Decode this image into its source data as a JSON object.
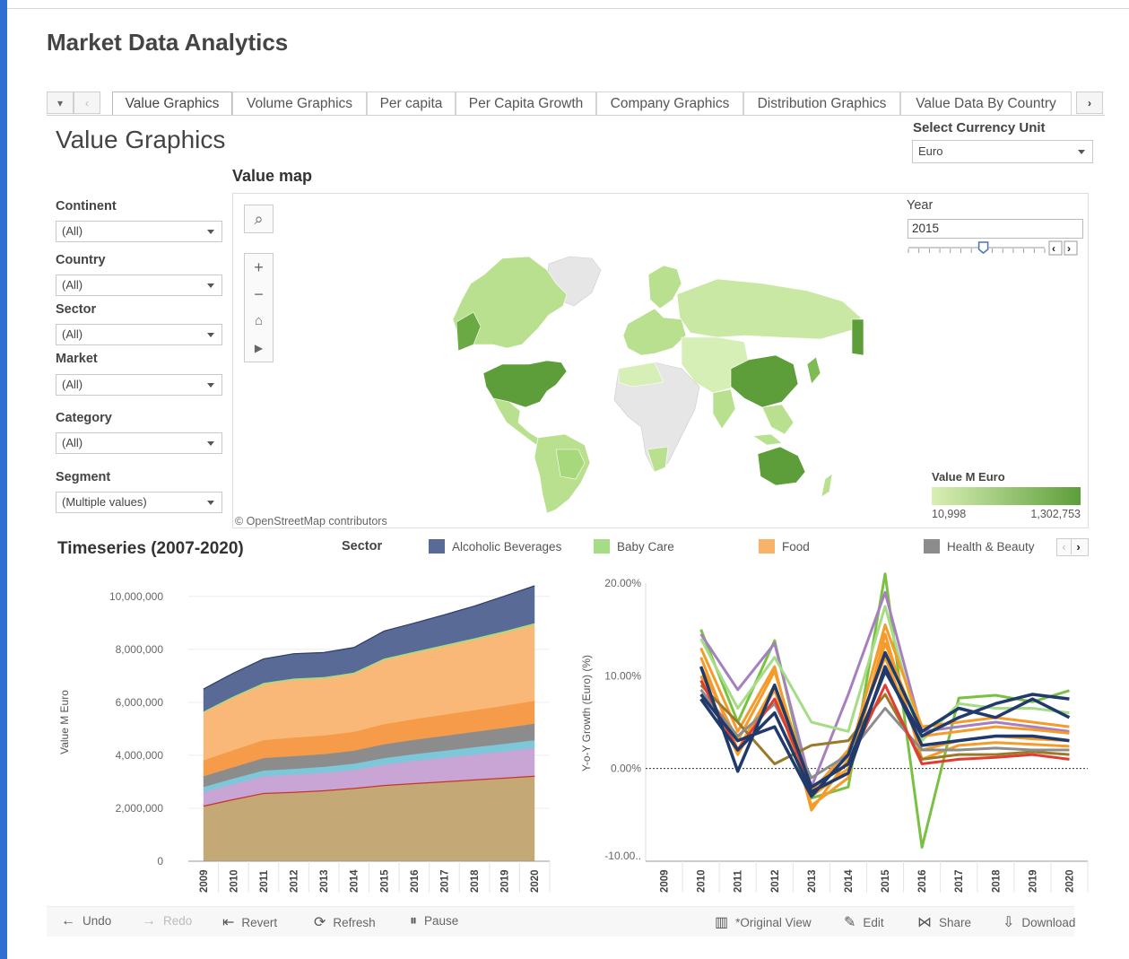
{
  "app_title": "Market Data Analytics",
  "tabs": {
    "items": [
      {
        "label": "Value Graphics",
        "active": true
      },
      {
        "label": "Volume Graphics"
      },
      {
        "label": "Per capita"
      },
      {
        "label": "Per Capita Growth"
      },
      {
        "label": "Company Graphics"
      },
      {
        "label": "Distribution Graphics"
      },
      {
        "label": "Value Data By Country"
      }
    ]
  },
  "dashboard_title": "Value Graphics",
  "currency": {
    "label": "Select Currency Unit",
    "value": "Euro"
  },
  "filters": [
    {
      "label": "Continent",
      "value": "(All)"
    },
    {
      "label": "Country",
      "value": "(All)"
    },
    {
      "label": "Sector",
      "value": "(All)"
    },
    {
      "label": "Market",
      "value": "(All)"
    },
    {
      "label": "Category",
      "value": "(All)"
    },
    {
      "label": "Segment",
      "value": "(Multiple values)"
    }
  ],
  "map": {
    "title": "Value map",
    "attribution": "© OpenStreetMap contributors",
    "year_label": "Year",
    "year_value": "2015",
    "legend_title": "Value M Euro",
    "legend_min": "10,998",
    "legend_max": "1,302,753",
    "legend_color_low": "#d9efb4",
    "legend_color_high": "#5d9e3a",
    "year_slider_fraction": 0.55
  },
  "timeseries": {
    "title": "Timeseries (2007-2020)",
    "legend_title": "Sector",
    "legend": [
      {
        "name": "Alcoholic Beverages",
        "color": "#5a6a96"
      },
      {
        "name": "Baby Care",
        "color": "#a5dc85"
      },
      {
        "name": "Food",
        "color": "#f9b26a"
      },
      {
        "name": "Health & Beauty",
        "color": "#8c8c8c"
      }
    ]
  },
  "chart_data": [
    {
      "type": "area",
      "ylabel": "Value M Euro",
      "ylim": [
        0,
        10500000
      ],
      "yticks": [
        "0",
        "2,000,000",
        "4,000,000",
        "6,000,000",
        "8,000,000",
        "10,000,000"
      ],
      "x": [
        "2009",
        "2010",
        "2011",
        "2012",
        "2013",
        "2014",
        "2015",
        "2016",
        "2017",
        "2018",
        "2019",
        "2020"
      ],
      "series": [
        {
          "color": "#c4a876",
          "values": [
            2100000,
            2350000,
            2580000,
            2620000,
            2680000,
            2770000,
            2880000,
            2950000,
            3020000,
            3090000,
            3160000,
            3230000
          ]
        },
        {
          "color": "#c9a5d6",
          "values": [
            500000,
            560000,
            620000,
            640000,
            650000,
            670000,
            760000,
            830000,
            880000,
            930000,
            980000,
            1040000
          ]
        },
        {
          "color": "#7ec7d8",
          "values": [
            200000,
            210000,
            220000,
            225000,
            230000,
            240000,
            250000,
            260000,
            270000,
            280000,
            290000,
            300000
          ]
        },
        {
          "color": "#8c8c8c",
          "values": [
            400000,
            430000,
            470000,
            480000,
            480000,
            490000,
            520000,
            540000,
            560000,
            580000,
            600000,
            620000
          ]
        },
        {
          "color": "#f59b4a",
          "values": [
            600000,
            640000,
            680000,
            700000,
            700000,
            710000,
            760000,
            780000,
            800000,
            820000,
            840000,
            860000
          ]
        },
        {
          "color": "#f9b877",
          "values": [
            1800000,
            1980000,
            2100000,
            2170000,
            2150000,
            2180000,
            2420000,
            2490000,
            2570000,
            2650000,
            2750000,
            2870000
          ]
        },
        {
          "color": "#a5dc85",
          "values": [
            50000,
            55000,
            60000,
            60000,
            60000,
            60000,
            60000,
            60000,
            65000,
            65000,
            70000,
            70000
          ]
        },
        {
          "color": "#5a6a96",
          "values": [
            850000,
            880000,
            910000,
            940000,
            930000,
            950000,
            1040000,
            1080000,
            1140000,
            1220000,
            1320000,
            1410000
          ]
        }
      ]
    },
    {
      "type": "line",
      "ylabel": "Y-o-Y Growth (Euro) (%)",
      "ylim": [
        -10,
        20
      ],
      "yticks": [
        "-10.00..",
        "0.00%",
        "10.00%",
        "20.00%"
      ],
      "x": [
        "2009",
        "2010",
        "2011",
        "2012",
        "2013",
        "2014",
        "2015",
        "2016",
        "2017",
        "2018",
        "2019",
        "2020"
      ],
      "series": [
        {
          "color": "#7ac143",
          "values": [
            null,
            15.0,
            5.0,
            13.8,
            -3.2,
            -2.0,
            21.0,
            -8.5,
            7.6,
            7.9,
            7.2,
            8.4
          ]
        },
        {
          "color": "#a67fc0",
          "values": [
            null,
            14.5,
            8.5,
            13.5,
            -2.0,
            8.0,
            19.0,
            4.0,
            4.5,
            5.0,
            4.5,
            4.0
          ]
        },
        {
          "color": "#a5dc85",
          "values": [
            null,
            14.0,
            6.5,
            12.0,
            5.0,
            4.0,
            17.5,
            3.0,
            7.0,
            6.5,
            6.5,
            6.0
          ]
        },
        {
          "color": "#f59b2a",
          "values": [
            null,
            13.0,
            4.0,
            11.0,
            -4.5,
            1.0,
            15.5,
            4.5,
            5.0,
            5.5,
            5.0,
            4.5
          ]
        },
        {
          "color": "#f59b2a",
          "values": [
            null,
            12.0,
            2.0,
            9.0,
            -3.0,
            0.0,
            13.5,
            3.5,
            4.0,
            4.5,
            4.2,
            3.8
          ]
        },
        {
          "color": "#f59b2a",
          "values": [
            null,
            11.0,
            3.0,
            10.5,
            -2.5,
            2.0,
            12.0,
            2.0,
            3.0,
            3.5,
            3.2,
            3.0
          ]
        },
        {
          "color": "#f59b2a",
          "values": [
            null,
            10.0,
            1.5,
            8.5,
            -4.0,
            -1.0,
            14.5,
            1.0,
            2.5,
            2.8,
            2.6,
            2.4
          ]
        },
        {
          "color": "#9a7a2a",
          "values": [
            null,
            9.0,
            5.0,
            0.5,
            2.5,
            3.0,
            8.0,
            1.0,
            1.5,
            1.5,
            1.8,
            1.5
          ]
        },
        {
          "color": "#8c8c8c",
          "values": [
            null,
            8.5,
            3.5,
            7.0,
            -1.0,
            1.5,
            6.5,
            2.0,
            2.0,
            2.2,
            2.0,
            2.0
          ]
        },
        {
          "color": "#e03c31",
          "values": [
            null,
            9.5,
            2.0,
            7.5,
            -2.0,
            0.5,
            9.0,
            0.5,
            1.0,
            1.2,
            1.5,
            1.0
          ]
        },
        {
          "color": "#1f3a6b",
          "values": [
            null,
            11.0,
            -0.3,
            9.0,
            -2.0,
            0.5,
            10.5,
            3.5,
            5.5,
            7.0,
            8.0,
            7.5
          ]
        },
        {
          "color": "#1f3a6b",
          "values": [
            null,
            8.0,
            3.0,
            4.5,
            -3.0,
            1.5,
            12.5,
            4.0,
            6.5,
            5.5,
            7.5,
            5.5
          ]
        },
        {
          "color": "#1f3a6b",
          "values": [
            null,
            7.5,
            2.0,
            6.0,
            -2.5,
            -0.5,
            11.0,
            2.5,
            3.0,
            3.5,
            3.5,
            3.0
          ]
        }
      ]
    }
  ],
  "toolbar": {
    "undo": "Undo",
    "redo": "Redo",
    "revert": "Revert",
    "refresh": "Refresh",
    "pause": "Pause",
    "original_view": "*Original View",
    "edit": "Edit",
    "share": "Share",
    "download": "Download"
  }
}
